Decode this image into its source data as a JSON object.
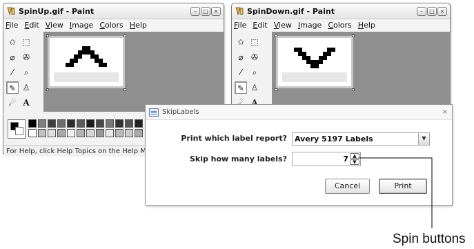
{
  "window_left": {
    "title": "SpinUp.gif - Paint",
    "menu": [
      "File",
      "Edit",
      "View",
      "Image",
      "Colors",
      "Help"
    ],
    "status": "For Help, click Help Topics on the Help Menu."
  },
  "window_right": {
    "title": "SpinDown.gif - Paint",
    "menu": [
      "File",
      "Edit",
      "View",
      "Image",
      "Colors",
      "Help"
    ]
  },
  "window_controls": {
    "minimize": "–",
    "maximize": "□",
    "close": "×"
  },
  "tools": {
    "text_tool": "A"
  },
  "dialog": {
    "title": "SkipLabels",
    "close_symbol": "×",
    "report_label": "Print which label report?",
    "report_value": "Avery 5197 Labels",
    "dropdown_arrow": "▼",
    "skip_label": "Skip how many labels?",
    "skip_value": "7",
    "spin_up": "▲",
    "spin_down": "▼",
    "cancel": "Cancel",
    "print": "Print"
  },
  "callout": {
    "text": "Spin buttons"
  },
  "colors": {
    "canvas_bg": "#8f8f8f",
    "pixel": "#000000"
  },
  "icons": [
    "paint-app-icon",
    "free-select-icon",
    "rect-select-icon",
    "eraser-icon",
    "fill-icon",
    "color-picker-icon",
    "magnifier-icon",
    "pencil-icon",
    "brush-icon",
    "airbrush-icon",
    "text-icon",
    "report-form-icon"
  ]
}
